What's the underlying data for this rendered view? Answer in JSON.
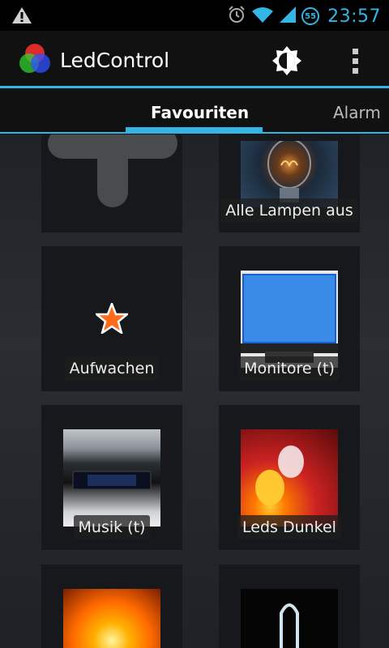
{
  "status_bar": {
    "time": "23:57",
    "notification_badge": "55",
    "icons": [
      "warning-icon",
      "alarm-clock-icon",
      "wifi-icon",
      "signal-icon"
    ],
    "accent_color": "#33b5e5"
  },
  "action_bar": {
    "title": "LedControl",
    "icons": [
      "rgb-circles-logo",
      "brightness-icon",
      "overflow-menu-icon"
    ]
  },
  "tabs": [
    {
      "label": "Favouriten",
      "selected": true
    },
    {
      "label": "Alarm",
      "selected": false
    }
  ],
  "tiles": [
    {
      "label": "",
      "image": "add-icon"
    },
    {
      "label": "Alle Lampen aus",
      "image": "light-bulb-image"
    },
    {
      "label": "Aufwachen",
      "image": "star-icon"
    },
    {
      "label": "Monitore (t)",
      "image": "monitor-image"
    },
    {
      "label": "Musik (t)",
      "image": "audio-device-image"
    },
    {
      "label": "Leds Dunkel",
      "image": "leds-image"
    },
    {
      "label": "",
      "image": "sun-image"
    },
    {
      "label": "",
      "image": "glass-tube-image"
    }
  ]
}
